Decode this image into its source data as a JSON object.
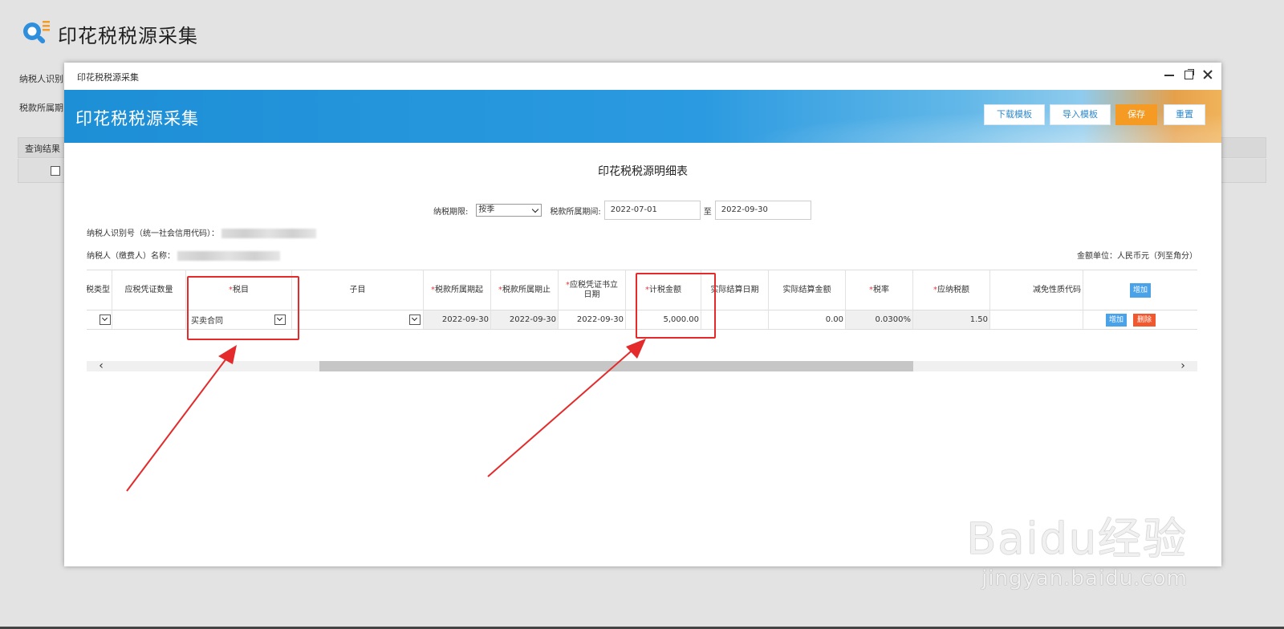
{
  "background": {
    "title": "印花税税源采集",
    "taxpayer_label": "纳税人识别",
    "period_label": "税款所属期",
    "result_label": "查询结果"
  },
  "dialog": {
    "window_title": "印花税税源采集",
    "banner_title": "印花税税源采集",
    "buttons": {
      "download": "下载模板",
      "import": "导入模板",
      "save": "保存",
      "reset": "重置"
    },
    "sheet_title": "印花税税源明细表",
    "period": {
      "term_label": "纳税期限:",
      "term_value": "按季",
      "range_label": "税款所属期间:",
      "from": "2022-07-01",
      "to_sep": "至",
      "to": "2022-09-30"
    },
    "taxpayer_id_label": "纳税人识别号（统一社会信用代码）：",
    "taxpayer_name_label": "纳税人（缴费人）名称：",
    "unit_label": "金额单位：人民币元（列至角分）",
    "table": {
      "headers": {
        "type": "税类型",
        "voucher_qty": "应税凭证数量",
        "item": "税目",
        "subitem": "子目",
        "period_start": "税款所属期起",
        "period_end": "税款所属期止",
        "voucher_date": "应税凭证书立日期",
        "amount": "计税金额",
        "settle_date": "实际结算日期",
        "settle_amount": "实际结算金额",
        "rate": "税率",
        "tax_due": "应纳税额",
        "relief_code": "减免性质代码",
        "add": "增加"
      },
      "row": {
        "item": "买卖合同",
        "period_start": "2022-09-30",
        "period_end": "2022-09-30",
        "voucher_date": "2022-09-30",
        "amount": "5,000.00",
        "settle_amount": "0.00",
        "rate": "0.0300%",
        "tax_due": "1.50",
        "add": "增加",
        "delete": "删除"
      }
    }
  },
  "watermark": {
    "brand": "Baidu经验",
    "url": "jingyan.baidu.com"
  },
  "colors": {
    "banner_blue": "#1d8fd6",
    "save_orange": "#f59a23",
    "highlight_red": "#e42a2a",
    "required_star": "#e23b3b"
  }
}
